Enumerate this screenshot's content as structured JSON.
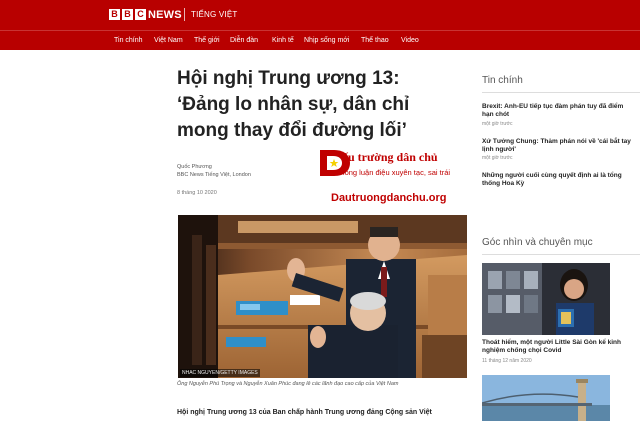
{
  "header": {
    "logo_letters": [
      "B",
      "B",
      "C"
    ],
    "brand": "NEWS",
    "language": "TIẾNG VIỆT"
  },
  "nav": {
    "items": [
      "Tin chính",
      "Việt Nam",
      "Thế giới",
      "Diễn đàn",
      "Kinh tế",
      "Nhịp sống mới",
      "Thể thao",
      "Video"
    ]
  },
  "article": {
    "headline_line1": "Hội nghị Trung ương 13:",
    "headline_line2": "‘Đảng lo nhân sự, dân chỉ",
    "headline_line3": "mong thay đổi đường lối’",
    "author": "Quốc Phương",
    "author_org": "BBC News Tiếng Việt, London",
    "date": "8 tháng 10 2020",
    "photo_credit": "NHAC NGUYEN/GETTY IMAGES",
    "caption": "Ông Nguyễn Phú Trọng và Nguyễn Xuân Phúc đang lê các lãnh đạo cao cấp của Việt Nam",
    "body_lead": "Hội nghị Trung ương 13 của Ban chấp hành Trung ương đảng Cộng sản Việt"
  },
  "watermark": {
    "logo_letter": "D",
    "title": "ấu trường dân chủ",
    "subtitle": "Chống luận điệu xuyên tạc, sai trái",
    "url": "Dautruongdanchu.org"
  },
  "sidebar": {
    "top_heading": "Tin chính",
    "news": [
      {
        "title": "Brexit: Anh-EU tiếp tục đàm phán tuy đã điểm hạn chót",
        "time": "một giờ trước"
      },
      {
        "title": "Xứ Tưởng Chung: Thảm phán nói về 'cái bắt tay lịnh người'",
        "time": "một giờ trước"
      },
      {
        "title": "Những người cuối cùng quyết định ai là tổng thống Hoa Kỳ",
        "time": "một giờ trước"
      }
    ],
    "opinion_heading": "Góc nhìn và chuyên mục",
    "feature": {
      "title": "Thoát hiểm, một người Little Sài Gòn kể kinh nghiệm chống chọi Covid",
      "time": "11 tháng 12 năm 2020"
    }
  },
  "colors": {
    "brand_red": "#b80000",
    "watermark_red": "#c00000"
  }
}
